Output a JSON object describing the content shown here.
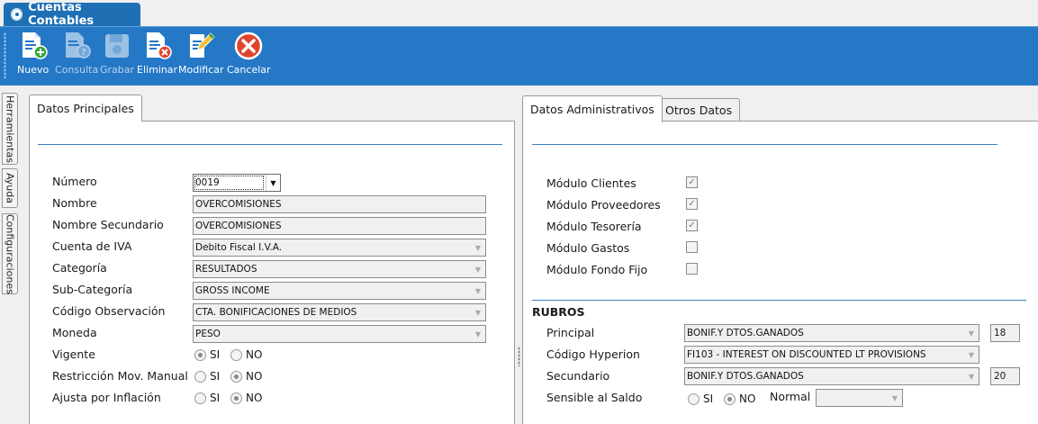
{
  "window": {
    "title": "Cuentas Contables"
  },
  "toolbar": {
    "buttons": [
      {
        "label": "Nuevo",
        "icon": "document-add-icon",
        "enabled": true
      },
      {
        "label": "Consulta",
        "icon": "document-query-icon",
        "enabled": false
      },
      {
        "label": "Grabar",
        "icon": "save-disk-icon",
        "enabled": false
      },
      {
        "label": "Eliminar",
        "icon": "document-delete-icon",
        "enabled": true
      },
      {
        "label": "Modificar",
        "icon": "document-edit-icon",
        "enabled": true
      },
      {
        "label": "Cancelar",
        "icon": "cancel-icon",
        "enabled": true
      }
    ]
  },
  "side_tabs": [
    "Herramientas",
    "Ayuda",
    "Configuraciones"
  ],
  "left_panel": {
    "tab": "Datos Principales",
    "fields": {
      "numero": {
        "label": "Número",
        "value": "0019"
      },
      "nombre": {
        "label": "Nombre",
        "value": "OVERCOMISIONES"
      },
      "nombre_secundario": {
        "label": "Nombre Secundario",
        "value": "OVERCOMISIONES"
      },
      "cuenta_iva": {
        "label": "Cuenta de IVA",
        "value": "Debito Fiscal I.V.A."
      },
      "categoria": {
        "label": "Categoría",
        "value": "RESULTADOS"
      },
      "sub_categoria": {
        "label": "Sub-Categoría",
        "value": "GROSS INCOME"
      },
      "codigo_observacion": {
        "label": "Código Observación",
        "value": "CTA. BONIFICACIONES DE MEDIOS"
      },
      "moneda": {
        "label": "Moneda",
        "value": "PESO"
      }
    },
    "radios": {
      "vigente": {
        "label": "Vigente",
        "si": "SI",
        "no": "NO",
        "selected": "SI"
      },
      "restriccion": {
        "label": "Restricción Mov. Manual",
        "si": "SI",
        "no": "NO",
        "selected": "NO"
      },
      "ajusta": {
        "label": "Ajusta por Inflación",
        "si": "SI",
        "no": "NO",
        "selected": "NO"
      }
    }
  },
  "right_panel": {
    "tabs": [
      "Datos Administrativos",
      "Otros Datos"
    ],
    "modules": [
      {
        "label": "Módulo Clientes",
        "checked": true
      },
      {
        "label": "Módulo Proveedores",
        "checked": true
      },
      {
        "label": "Módulo Tesorería",
        "checked": true
      },
      {
        "label": "Módulo Gastos",
        "checked": false
      },
      {
        "label": "Módulo Fondo Fijo",
        "checked": false
      }
    ],
    "rubros": {
      "title": "RUBROS",
      "principal": {
        "label": "Principal",
        "value": "BONIF.Y DTOS.GANADOS",
        "num": "18"
      },
      "codigo_hyperion": {
        "label": "Código Hyperion",
        "value": "FI103 - INTEREST ON DISCOUNTED LT PROVISIONS"
      },
      "secundario": {
        "label": "Secundario",
        "value": "BONIF.Y DTOS.GANADOS",
        "num": "20"
      },
      "sensible": {
        "label": "Sensible al Saldo",
        "si": "SI",
        "no": "NO",
        "selected": "NO",
        "normal_label": "Normal",
        "normal_value": ""
      }
    }
  }
}
